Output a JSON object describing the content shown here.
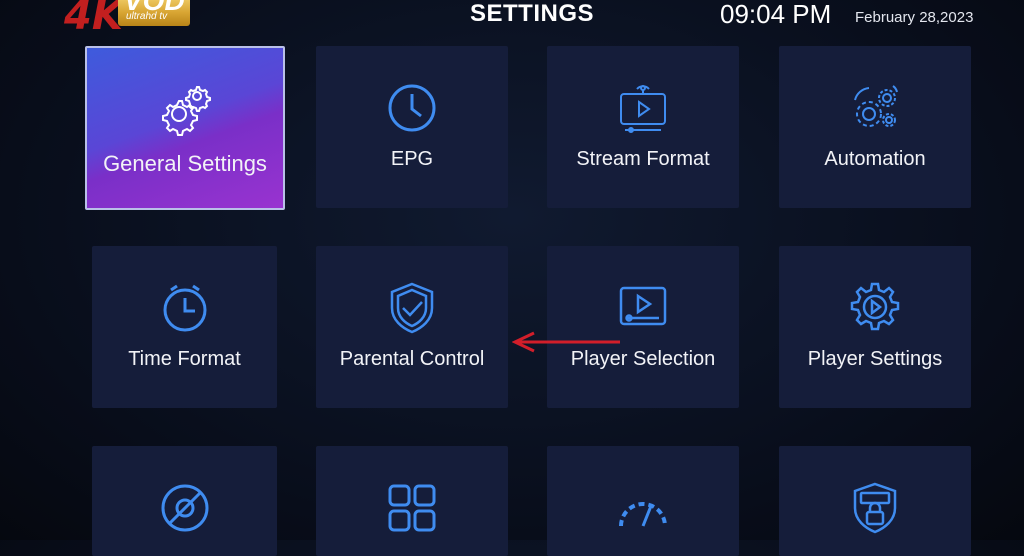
{
  "brand": {
    "mark": "4K",
    "name": "VOD",
    "tagline": "ultrahd tv"
  },
  "header": {
    "title": "SETTINGS",
    "time": "09:04 PM",
    "date": "February 28,2023"
  },
  "tiles": [
    {
      "label": "General Settings",
      "icon": "gear-cluster-icon",
      "selected": true
    },
    {
      "label": "EPG",
      "icon": "clock-icon"
    },
    {
      "label": "Stream Format",
      "icon": "stream-monitor-icon"
    },
    {
      "label": "Automation",
      "icon": "automation-gears-icon"
    },
    {
      "label": "Time Format",
      "icon": "time-clock-icon"
    },
    {
      "label": "Parental Control",
      "icon": "shield-check-icon"
    },
    {
      "label": "Player Selection",
      "icon": "player-screen-icon"
    },
    {
      "label": "Player Settings",
      "icon": "player-settings-gear-icon"
    },
    {
      "label": "",
      "icon": "speaker-off-icon"
    },
    {
      "label": "",
      "icon": "grid-apps-icon"
    },
    {
      "label": "",
      "icon": "speedometer-icon"
    },
    {
      "label": "",
      "icon": "vpn-shield-icon"
    }
  ],
  "colors": {
    "icon": "#3f8cf0",
    "tile": "#151d3a",
    "annotation_arrow": "#d21e2a"
  }
}
